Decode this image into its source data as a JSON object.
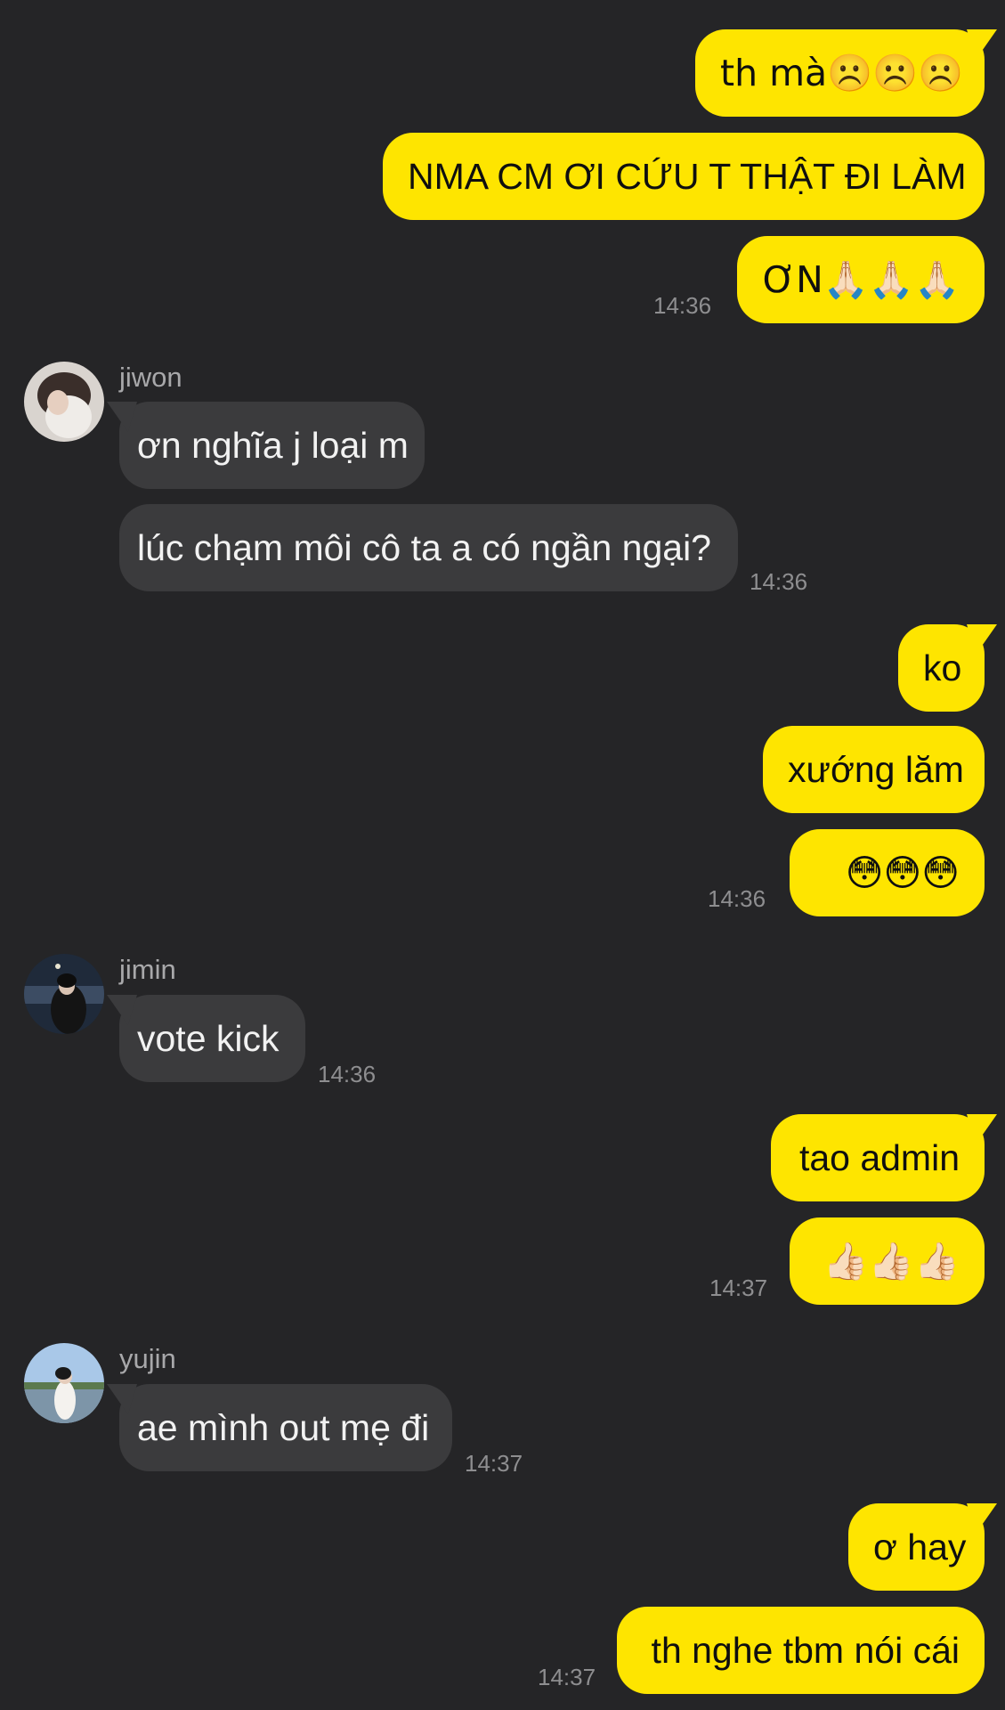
{
  "colors": {
    "background": "#252527",
    "outgoing_bubble": "#fee500",
    "incoming_bubble": "#3b3b3d",
    "timestamp": "#8e8e90",
    "sender_name": "#a8a8aa"
  },
  "messages": [
    {
      "direction": "out",
      "text": "th mà☹️☹️☹️"
    },
    {
      "direction": "out",
      "text": "NMA CM ƠI CỨU T THẬT ĐI LÀM"
    },
    {
      "direction": "out",
      "text": "ƠN🙏🏻🙏🏻🙏🏻",
      "time": "14:36"
    },
    {
      "direction": "in",
      "sender": "jiwon",
      "avatar": "avatar-jiwon",
      "text": "ơn nghĩa j loại m"
    },
    {
      "direction": "in",
      "text": "lúc chạm môi cô ta a có ngần ngại?",
      "time": "14:36"
    },
    {
      "direction": "out",
      "text": "ko"
    },
    {
      "direction": "out",
      "text": "xướng lăm"
    },
    {
      "direction": "out",
      "text": "😳😳😳",
      "time": "14:36"
    },
    {
      "direction": "in",
      "sender": "jimin",
      "avatar": "avatar-jimin",
      "text": "vote kick",
      "time": "14:36"
    },
    {
      "direction": "out",
      "text": "tao admin"
    },
    {
      "direction": "out",
      "text": "👍🏻👍🏻👍🏻",
      "time": "14:37"
    },
    {
      "direction": "in",
      "sender": "yujin",
      "avatar": "avatar-yujin",
      "text": "ae mình out mẹ đi",
      "time": "14:37"
    },
    {
      "direction": "out",
      "text": "ơ hay"
    },
    {
      "direction": "out",
      "text": "th nghe tbm nói cái",
      "time": "14:37"
    }
  ]
}
